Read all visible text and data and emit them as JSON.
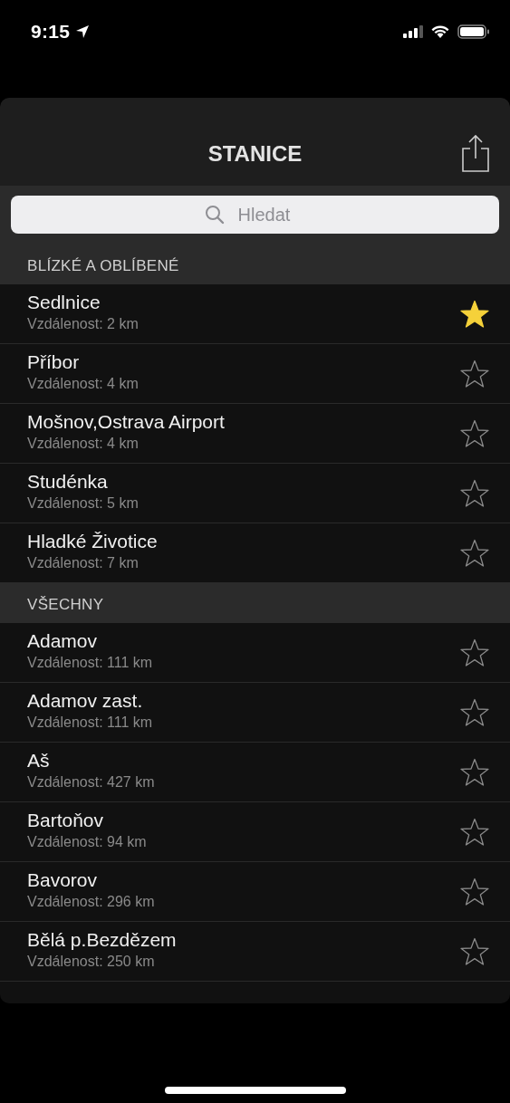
{
  "status_bar": {
    "time": "9:15"
  },
  "title": "STANICE",
  "search": {
    "placeholder": "Hledat"
  },
  "sections": [
    {
      "header": "BLÍZKÉ A OBLÍBENÉ",
      "stations": [
        {
          "name": "Sedlnice",
          "distance": "Vzdálenost: 2 km",
          "favorite": true
        },
        {
          "name": "Příbor",
          "distance": "Vzdálenost: 4 km",
          "favorite": false
        },
        {
          "name": "Mošnov,Ostrava Airport",
          "distance": "Vzdálenost: 4 km",
          "favorite": false
        },
        {
          "name": "Studénka",
          "distance": "Vzdálenost: 5 km",
          "favorite": false
        },
        {
          "name": "Hladké Životice",
          "distance": "Vzdálenost: 7 km",
          "favorite": false
        }
      ]
    },
    {
      "header": "VŠECHNY",
      "stations": [
        {
          "name": "Adamov",
          "distance": "Vzdálenost: 111 km",
          "favorite": false
        },
        {
          "name": "Adamov zast.",
          "distance": "Vzdálenost: 111 km",
          "favorite": false
        },
        {
          "name": "Aš",
          "distance": "Vzdálenost: 427 km",
          "favorite": false
        },
        {
          "name": "Bartoňov",
          "distance": "Vzdálenost: 94 km",
          "favorite": false
        },
        {
          "name": "Bavorov",
          "distance": "Vzdálenost: 296 km",
          "favorite": false
        },
        {
          "name": "Bělá p.Bezdězem",
          "distance": "Vzdálenost: 250 km",
          "favorite": false
        }
      ]
    }
  ]
}
